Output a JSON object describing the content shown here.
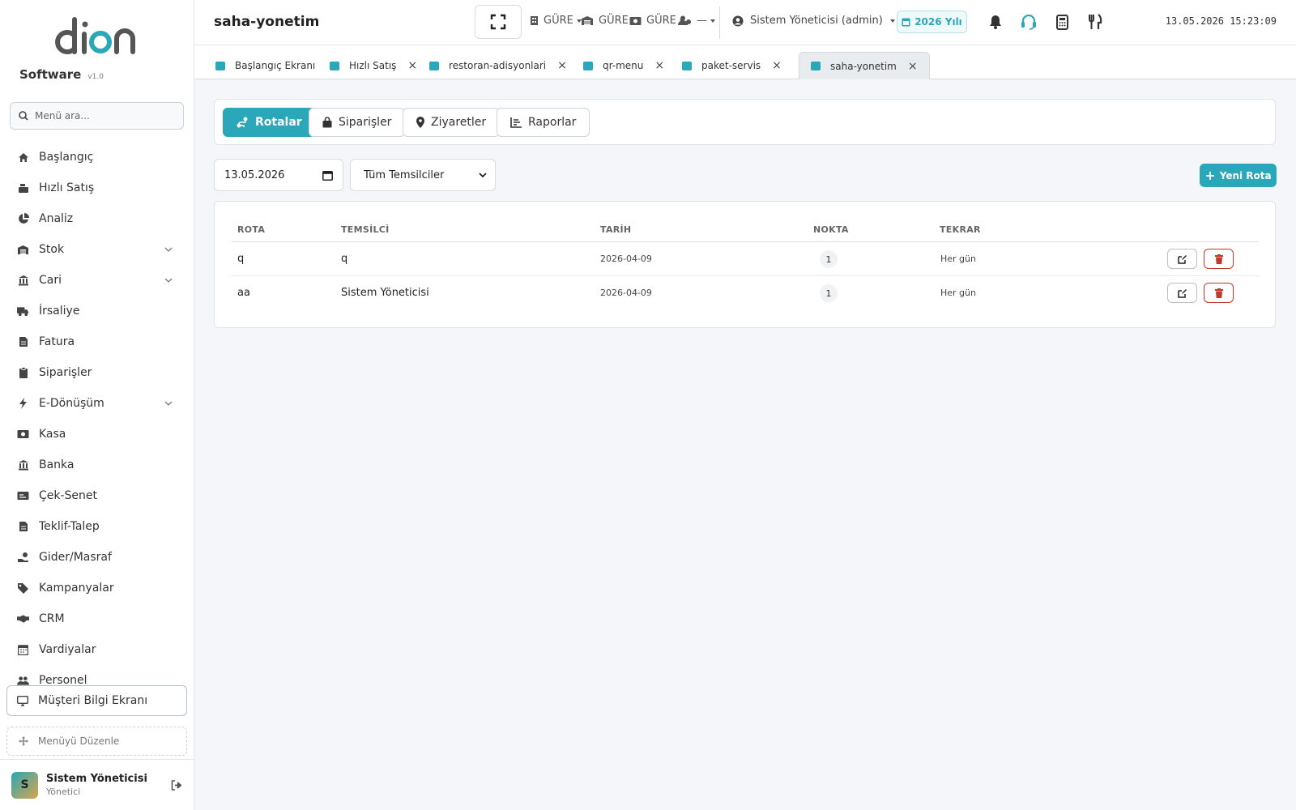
{
  "sidebar": {
    "brand": "Software",
    "version": "v1.0",
    "search_placeholder": "Menü ara...",
    "items": [
      {
        "label": "Başlangıç"
      },
      {
        "label": "Hızlı Satış"
      },
      {
        "label": "Analiz"
      },
      {
        "label": "Stok"
      },
      {
        "label": "Cari"
      },
      {
        "label": "İrsaliye"
      },
      {
        "label": "Fatura"
      },
      {
        "label": "Siparişler"
      },
      {
        "label": "E-Dönüşüm"
      },
      {
        "label": "Kasa"
      },
      {
        "label": "Banka"
      },
      {
        "label": "Çek-Senet"
      },
      {
        "label": "Teklif-Talep"
      },
      {
        "label": "Gider/Masraf"
      },
      {
        "label": "Kampanyalar"
      },
      {
        "label": "CRM"
      },
      {
        "label": "Vardiyalar"
      },
      {
        "label": "Personel"
      }
    ],
    "customer_screen": "Müşteri Bilgi Ekranı",
    "edit_menu": "Menüyü Düzenle",
    "user": {
      "initial": "S",
      "name": "Sistem Yöneticisi",
      "role": "Yönetici"
    }
  },
  "header": {
    "title": "saha-yonetim",
    "selectors": [
      "GÜRE",
      "GÜRE",
      "GÜRE",
      "—"
    ],
    "user": "Sistem Yöneticisi (admin)",
    "year": "2026 Yılı",
    "datetime": "13.05.2026 15:23:09"
  },
  "tabs": [
    {
      "label": "Başlangıç Ekranı"
    },
    {
      "label": "Hızlı Satış",
      "close": "×"
    },
    {
      "label": "restoran-adisyonlari",
      "close": "×"
    },
    {
      "label": "qr-menu",
      "close": "×"
    },
    {
      "label": "paket-servis",
      "close": "×"
    },
    {
      "label": "saha-yonetim",
      "close": "×"
    }
  ],
  "section_tabs": [
    {
      "label": "Rotalar"
    },
    {
      "label": "Siparişler"
    },
    {
      "label": "Ziyaretler"
    },
    {
      "label": "Raporlar"
    }
  ],
  "filters": {
    "date": "13.05.2026",
    "representative": "Tüm Temsilciler",
    "new_route": "Yeni Rota"
  },
  "table": {
    "headers": {
      "route": "ROTA",
      "rep": "TEMSİLCİ",
      "date": "TARİH",
      "points": "NOKTA",
      "repeat": "TEKRAR"
    },
    "rows": [
      {
        "route": "q",
        "rep": "q",
        "date": "2026-04-09",
        "points": "1",
        "repeat": "Her gün"
      },
      {
        "route": "aa",
        "rep": "Sistem Yöneticisi",
        "date": "2026-04-09",
        "points": "1",
        "repeat": "Her gün"
      }
    ]
  },
  "colors": {
    "accent": "#2aa7b8",
    "danger": "#c0392b"
  }
}
